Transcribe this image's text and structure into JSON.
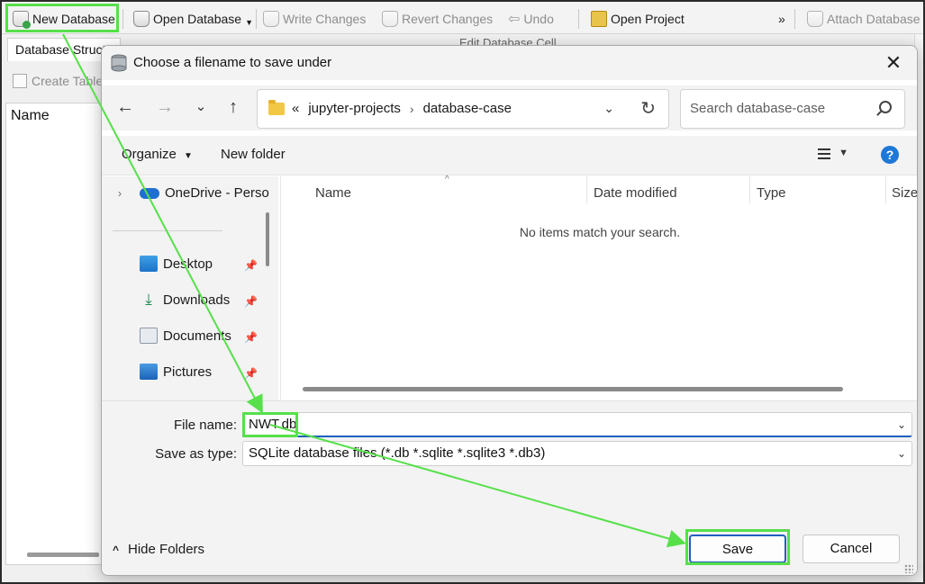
{
  "toolbar": {
    "new_database": "New Database",
    "open_database": "Open Database",
    "write_changes": "Write Changes",
    "revert_changes": "Revert Changes",
    "undo": "Undo",
    "open_project": "Open Project",
    "more": "»",
    "attach_database": "Attach Database"
  },
  "background": {
    "tab_label": "Database Structu",
    "create_table": "Create Table",
    "name_header": "Name",
    "edit_cell_title": "Edit Database Cell"
  },
  "dialog": {
    "title": "Choose a filename to save under",
    "close": "✕",
    "address": {
      "overflow": "«",
      "crumbs": [
        "jupyter-projects",
        "database-case"
      ],
      "separator": "›"
    },
    "search_placeholder": "Search database-case",
    "commands": {
      "organize": "Organize",
      "new_folder": "New folder",
      "help": "?"
    },
    "nav": {
      "onedrive": "OneDrive - Perso",
      "items": [
        {
          "label": "Desktop",
          "icon": "desktop-icon"
        },
        {
          "label": "Downloads",
          "icon": "downloads-icon"
        },
        {
          "label": "Documents",
          "icon": "documents-icon"
        },
        {
          "label": "Pictures",
          "icon": "pictures-icon"
        }
      ]
    },
    "columns": [
      "Name",
      "Date modified",
      "Type",
      "Size"
    ],
    "empty_message": "No items match your search.",
    "file_name_label": "File name:",
    "file_name_value": "NWT.db",
    "save_as_type_label": "Save as type:",
    "save_as_type_value": "SQLite database files (*.db *.sqlite *.sqlite3 *.db3)",
    "hide_folders": "Hide Folders",
    "save": "Save",
    "cancel": "Cancel"
  },
  "colors": {
    "highlight": "#56e04a",
    "accent": "#1f5fbf"
  }
}
